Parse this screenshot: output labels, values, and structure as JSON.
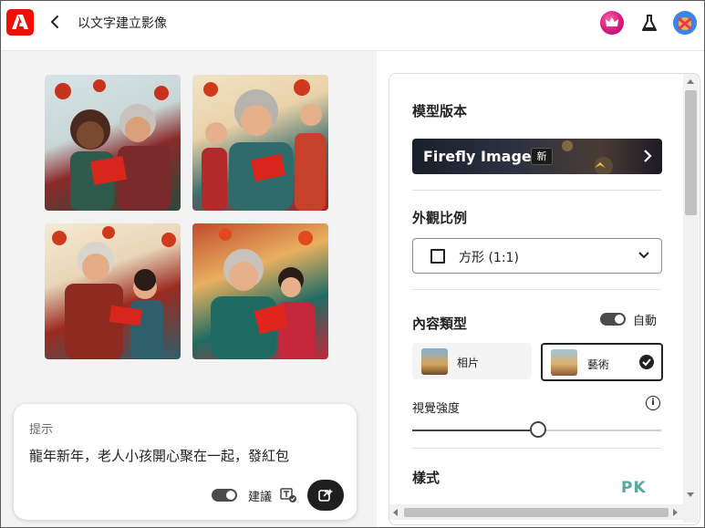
{
  "header": {
    "title": "以文字建立影像"
  },
  "prompt": {
    "label": "提示",
    "text": "龍年新年，老人小孩開心聚在一起，發紅包",
    "suggestions_label": "建議"
  },
  "panel": {
    "model_section_title": "模型版本",
    "model_name": "Firefly Image 2",
    "model_badge": "新",
    "aspect_section_title": "外觀比例",
    "aspect_value": "方形 (1:1)",
    "content_type_title": "內容類型",
    "auto_label": "自動",
    "content_types": [
      {
        "label": "相片",
        "selected": false
      },
      {
        "label": "藝術",
        "selected": true
      }
    ],
    "visual_intensity_label": "視覺強度",
    "visual_intensity_value": 0.5,
    "style_section_title": "樣式"
  },
  "colors": {
    "brand": "#eb1000",
    "accent": "#222222"
  },
  "watermark": "PK"
}
